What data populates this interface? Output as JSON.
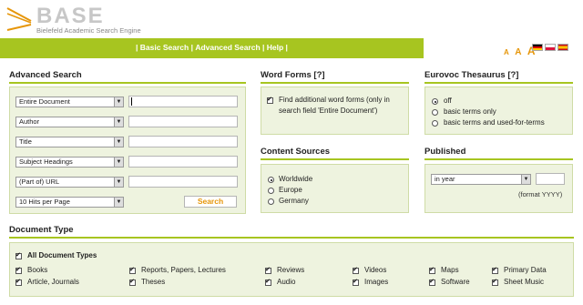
{
  "header": {
    "logo_text": "BASE",
    "logo_sub": "Bielefeld Academic Search Engine",
    "nav_basic": "Basic Search",
    "nav_advanced": "Advanced Search",
    "nav_help": "Help",
    "font_small": "A",
    "font_medium": "A",
    "font_large": "A"
  },
  "advanced": {
    "title": "Advanced Search",
    "field1": "Entire Document",
    "field2": "Author",
    "field3": "Title",
    "field4": "Subject Headings",
    "field5": "(Part of) URL",
    "hits": "10 Hits per Page",
    "search_label": "Search"
  },
  "word_forms": {
    "title": "Word Forms [?]",
    "label_line1": "Find additional word forms (only in",
    "label_line2": "search field 'Entire Document')"
  },
  "eurovoc": {
    "title": "Eurovoc Thesaurus [?]",
    "options": [
      "off",
      "basic terms only",
      "basic terms and used-for-terms"
    ]
  },
  "content_sources": {
    "title": "Content Sources",
    "options": [
      "Worldwide",
      "Europe",
      "Germany"
    ]
  },
  "published": {
    "title": "Published",
    "select": "in year",
    "format_note": "(format YYYY)"
  },
  "doc_type": {
    "title": "Document Type",
    "all": "All Document Types",
    "col1": [
      "Books",
      "Article, Journals"
    ],
    "col2": [
      "Reports, Papers, Lectures",
      "Theses"
    ],
    "col3": [
      "Reviews",
      "Audio"
    ],
    "col4": [
      "Videos",
      "Images"
    ],
    "col5": [
      "Maps",
      "Software"
    ],
    "col6": [
      "Primary Data",
      "Sheet Music"
    ]
  },
  "colors": {
    "accent": "#a7c520",
    "panel": "#eef3df",
    "orange": "#e6960a"
  }
}
